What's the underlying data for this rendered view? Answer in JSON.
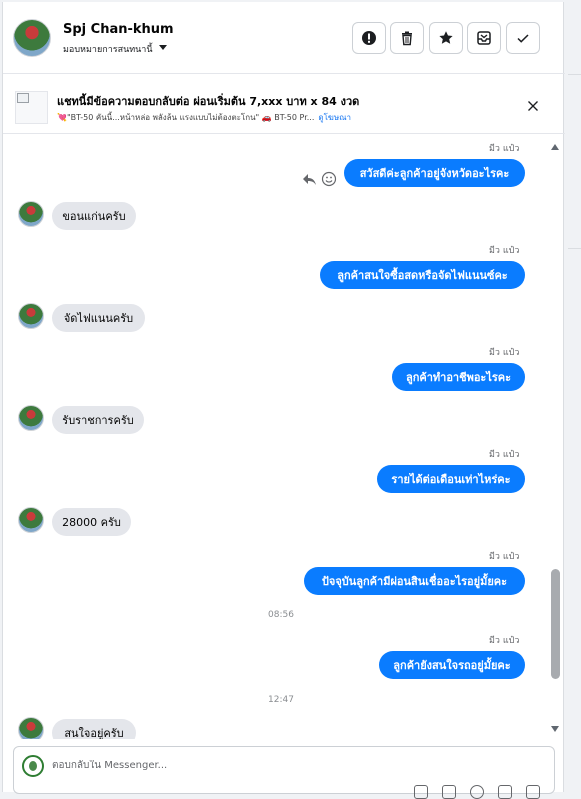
{
  "header": {
    "name": "Spj Chan-khum",
    "assign_label": "มอบหมายการสนทนานี้",
    "actions": [
      "spam",
      "delete",
      "star",
      "archive",
      "done"
    ]
  },
  "ad": {
    "title": "แชทนี้มีข้อความตอบกลับต่อ ผ่อนเริ่มต้น 7,xxx บาท x 84 งวด",
    "description": "💘\"BT-50 คันนี้...หน้าหล่อ พลังล้น แรงแบบไม่ต้องตะโกน\" 🚗 BT-50 Pr...",
    "link_label": "ดูโฆษณา"
  },
  "messages": [
    {
      "from": "page",
      "seen": "มีว แป๋ว",
      "text": "สวัสดีค่ะลูกค้าอยู่จังหวัดอะไรคะ"
    },
    {
      "from": "customer",
      "text": "ขอนแก่นครับ"
    },
    {
      "from": "page",
      "seen": "มีว แป๋ว",
      "text": "ลูกค้าสนใจซื้อสดหรือจัดไฟแนนซ์คะ"
    },
    {
      "from": "customer",
      "text": "จัดไฟแนนครับ"
    },
    {
      "from": "page",
      "seen": "มีว แป๋ว",
      "text": "ลูกค้าทำอาชีพอะไรคะ"
    },
    {
      "from": "customer",
      "text": "รับราชการครับ"
    },
    {
      "from": "page",
      "seen": "มีว แป๋ว",
      "text": "รายได้ต่อเดือนเท่าไหร่คะ"
    },
    {
      "from": "customer",
      "text": "28000 ครับ"
    },
    {
      "from": "page",
      "seen": "มีว แป๋ว",
      "text": "ปัจจุบันลูกค้ามีผ่อนสินเชื่ออะไรอยู่มั้ยคะ"
    },
    {
      "from": "page",
      "seen": "มีว แป๋ว",
      "text": "ลูกค้ายังสนใจรถอยู่มั้ยคะ"
    },
    {
      "from": "customer",
      "text": "สนใจอยู่ครับ"
    }
  ],
  "timestamps": [
    "08:56",
    "12:47"
  ],
  "composer": {
    "placeholder": "ตอบกลับใน Messenger..."
  }
}
